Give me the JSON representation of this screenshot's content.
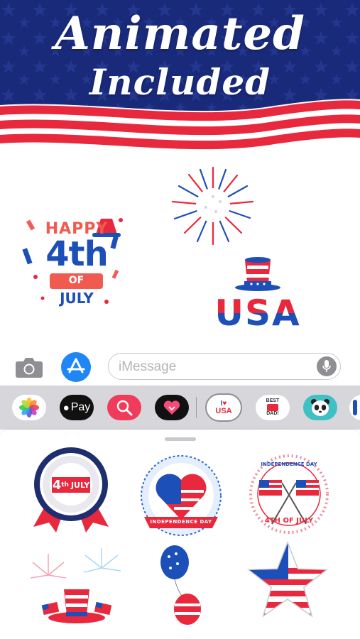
{
  "banner": {
    "line1": "Animated",
    "line2": "Included",
    "colors": {
      "navy": "#1a2a7a",
      "red": "#e8283c",
      "white": "#ffffff"
    }
  },
  "preview_stickers": {
    "happy_4th": {
      "line1": "HAPPY",
      "line2": "4th",
      "line3": "OF",
      "line4": "JULY"
    },
    "usa_hat": {
      "text": "USA"
    }
  },
  "message_bar": {
    "camera_icon": "camera-icon",
    "appstore_icon": "app-store-icon",
    "placeholder": "iMessage",
    "mic_icon": "microphone-icon"
  },
  "app_drawer": {
    "apps": [
      {
        "name": "photos-app-icon"
      },
      {
        "name": "apple-pay-app",
        "label": "Pay"
      },
      {
        "name": "search-images-app-icon"
      },
      {
        "name": "digital-touch-app-icon"
      },
      {
        "name": "i-love-usa-sticker-app",
        "line1": "I",
        "line2": "USA"
      },
      {
        "name": "best-dad-sticker-app",
        "line1": "BEST",
        "line2": "DAD!"
      },
      {
        "name": "panda-sticker-app"
      },
      {
        "name": "more-app-partial"
      }
    ]
  },
  "sticker_grid": {
    "item1": {
      "text1": "4",
      "text2": "th",
      "text3": "JULY"
    },
    "item2": {
      "text": "INDEPENDENCE DAY"
    },
    "item3": {
      "top": "INDEPENDENCE DAY",
      "bottom": "4TH OF JULY"
    },
    "item4": {
      "text": "uncle-sam-hat-fireworks"
    },
    "item5": {
      "text": "balloons"
    },
    "item6": {
      "text": "flag-star"
    }
  }
}
